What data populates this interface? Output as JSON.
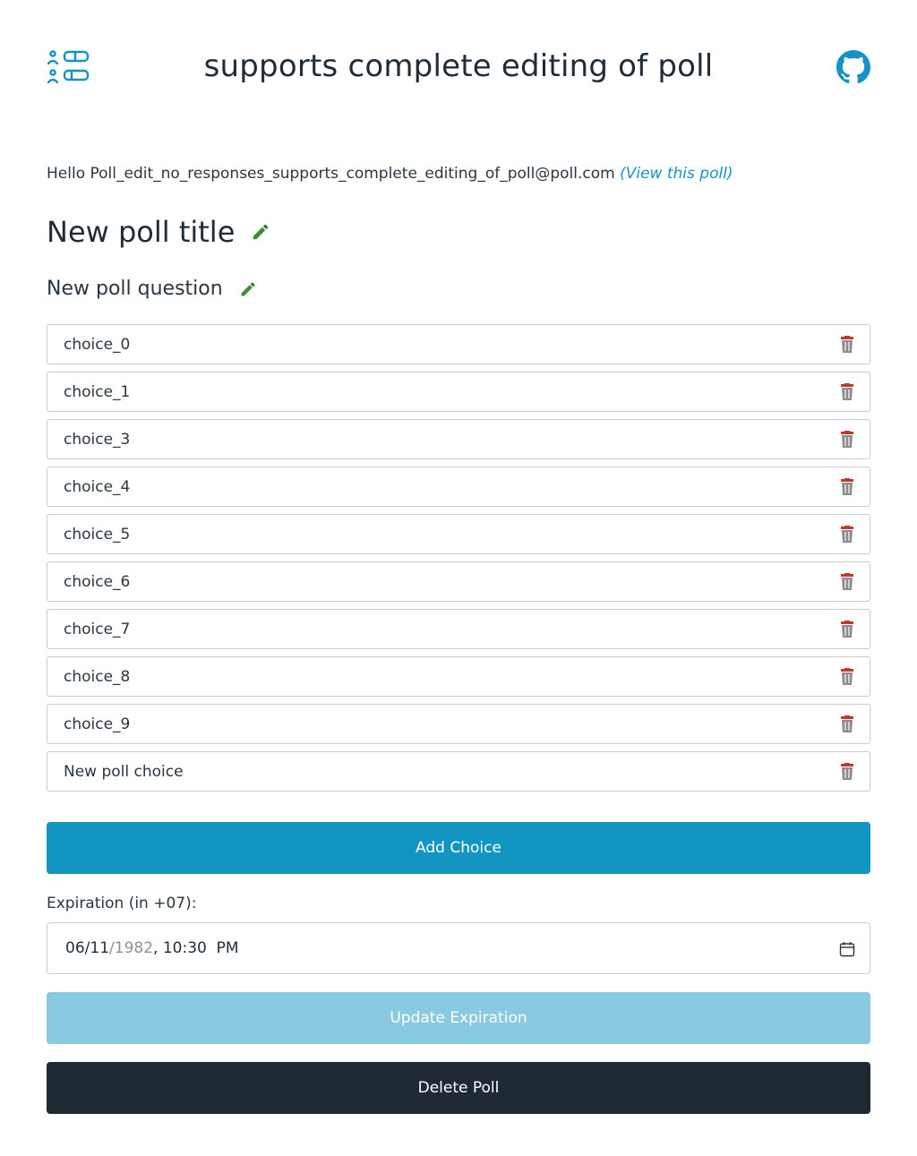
{
  "header": {
    "title": "supports complete editing of poll"
  },
  "greeting": {
    "prefix": "Hello Poll_edit_no_responses_supports_complete_editing_of_poll@poll.com",
    "view_link": "(View this poll)"
  },
  "poll": {
    "title": "New poll title",
    "question": "New poll question",
    "choices": [
      "choice_0",
      "choice_1",
      "choice_3",
      "choice_4",
      "choice_5",
      "choice_6",
      "choice_7",
      "choice_8",
      "choice_9",
      "New poll choice"
    ]
  },
  "buttons": {
    "add_choice": "Add Choice",
    "update_expiration": "Update Expiration",
    "delete_poll": "Delete Poll"
  },
  "expiration": {
    "label": "Expiration (in +07):",
    "month": "06",
    "day": "11",
    "year": "1982",
    "time": "10:30  PM"
  },
  "colors": {
    "primary": "#1395c3",
    "primary_disabled": "#89cae0",
    "dark": "#1e2933",
    "edit_green": "#3b8f3b",
    "trash_red": "#c0392b",
    "trash_gray": "#8c8c8c"
  },
  "icons": {
    "logo": "poll-logo-icon",
    "github": "github-icon",
    "edit": "pencil-icon",
    "delete": "trash-icon",
    "calendar": "calendar-icon"
  }
}
